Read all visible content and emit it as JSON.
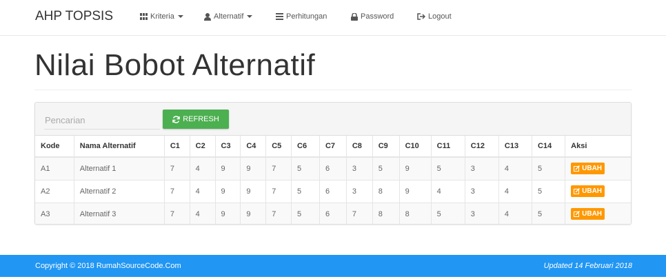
{
  "navbar": {
    "brand": "AHP TOPSIS",
    "items": [
      {
        "label": "Kriteria",
        "icon": "grid-icon",
        "dropdown": true
      },
      {
        "label": "Alternatif",
        "icon": "user-icon",
        "dropdown": true
      },
      {
        "label": "Perhitungan",
        "icon": "list-icon",
        "dropdown": false
      },
      {
        "label": "Password",
        "icon": "lock-icon",
        "dropdown": false
      },
      {
        "label": "Logout",
        "icon": "logout-icon",
        "dropdown": false
      }
    ]
  },
  "page": {
    "title": "Nilai Bobot Alternatif"
  },
  "toolbar": {
    "search_placeholder": "Pencarian",
    "refresh_label": "REFRESH"
  },
  "table": {
    "headers": [
      "Kode",
      "Nama Alternatif",
      "C1",
      "C2",
      "C3",
      "C4",
      "C5",
      "C6",
      "C7",
      "C8",
      "C9",
      "C10",
      "C11",
      "C12",
      "C13",
      "C14",
      "Aksi"
    ],
    "rows": [
      {
        "kode": "A1",
        "nama": "Alternatif 1",
        "values": [
          "7",
          "4",
          "9",
          "9",
          "7",
          "5",
          "6",
          "3",
          "5",
          "9",
          "5",
          "3",
          "4",
          "5"
        ],
        "action": "UBAH"
      },
      {
        "kode": "A2",
        "nama": "Alternatif 2",
        "values": [
          "7",
          "4",
          "9",
          "9",
          "7",
          "5",
          "6",
          "3",
          "8",
          "9",
          "4",
          "3",
          "4",
          "5"
        ],
        "action": "UBAH"
      },
      {
        "kode": "A3",
        "nama": "Alternatif 3",
        "values": [
          "7",
          "4",
          "9",
          "9",
          "7",
          "5",
          "6",
          "7",
          "8",
          "8",
          "5",
          "3",
          "4",
          "5"
        ],
        "action": "UBAH"
      }
    ]
  },
  "footer": {
    "copyright": "Copyright © 2018 RumahSourceCode.Com",
    "updated": "Updated 14 Februari 2018"
  },
  "colors": {
    "refresh": "#4caf50",
    "ubah": "#ff9800",
    "footer": "#2196f3"
  }
}
